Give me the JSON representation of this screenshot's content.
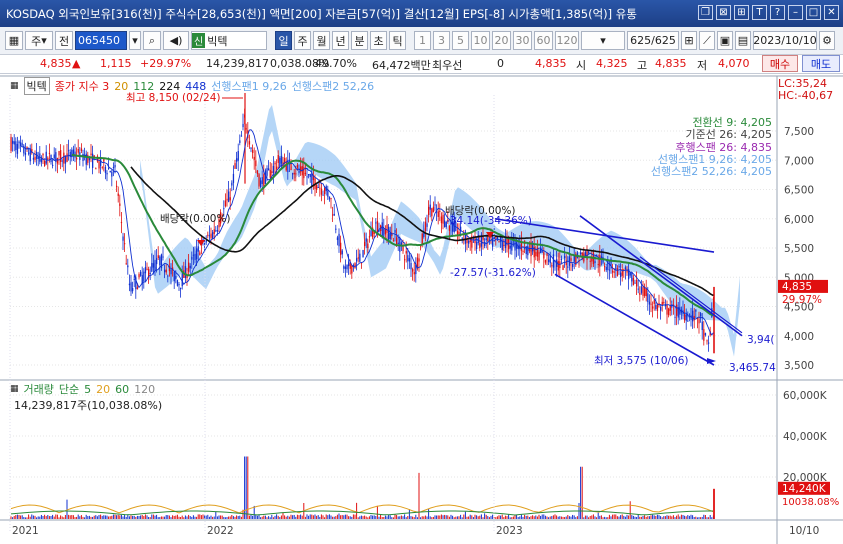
{
  "title_bar": {
    "text": "KOSDAQ 외국인보유[316(천)] 주식수[28,653(천)] 액면[200] 자본금[57(억)] 결산[12월] EPS[-8] 시가총액[1,385(억)] 유통",
    "icons": [
      "restore-icon",
      "close-box-icon",
      "pin-icon",
      "T",
      "?",
      "minimize-icon",
      "maximize-icon",
      "close-icon"
    ]
  },
  "toolbar": {
    "market": "주",
    "prev": "전",
    "code": "065450",
    "name_badge": "신",
    "name": "빅텍",
    "periods": [
      "일",
      "주",
      "월",
      "년",
      "분",
      "초",
      "틱"
    ],
    "active_period": "일",
    "intervals": [
      "1",
      "3",
      "5",
      "10",
      "20",
      "30",
      "60",
      "120"
    ],
    "count": "625/625",
    "date": "2023/10/10"
  },
  "quote": {
    "price": "4,835",
    "arrow": "▲",
    "change": "1,115",
    "rate": "+29.97%",
    "volume": "14,239,817",
    "vol_ratio": "0,038.08%",
    "pct2": "49.70%",
    "amount": "64,472백만",
    "pref_label": "최우선",
    "pref_value": "0",
    "cur": "4,835",
    "open_label": "시",
    "open": "4,325",
    "high_label": "고",
    "high": "4,835",
    "low_label": "저",
    "low": "4,070",
    "buy": "매수",
    "sell": "매도"
  },
  "price_pane": {
    "name_tag": "빅텍",
    "ma_label": "종가 지수 3",
    "ma_periods": [
      "20",
      "112",
      "224",
      "448"
    ],
    "span1": "선행스팬1 9,26",
    "span2": "선행스팬2 52,26",
    "lc": "LC:35,24",
    "hc": "HC:-40,67",
    "legend": [
      {
        "text": "전환선 9: 4,205",
        "color": "#2a8a3a"
      },
      {
        "text": "기준선 26: 4,205",
        "color": "#444444"
      },
      {
        "text": "후행스팬 26: 4,835",
        "color": "#9a2ab0"
      },
      {
        "text": "선행스팬1 9,26: 4,205",
        "color": "#6aa8e8"
      },
      {
        "text": "선행스팬2 52,26: 4,205",
        "color": "#6aa8e8"
      }
    ],
    "annotations": {
      "high": "최고 8,150 (02/24)",
      "low": "최저 3,575 (10/06)",
      "ex_div1": "배당락(0.00%)",
      "ex_div2": "배당락(0.00%)",
      "pct_upper": "-34.14(-34.36%)",
      "pct_lower": "-27.57(-31.62%)",
      "line_upper_end": "3,94(",
      "line_lower_end": "3,465.74"
    },
    "y_ticks": [
      "7,500",
      "7,000",
      "6,500",
      "6,000",
      "5,500",
      "5,000",
      "4,500",
      "4,000",
      "3,500"
    ],
    "cur_price_tag": "4,835",
    "cur_rate_tag": "29.97%"
  },
  "volume_pane": {
    "title": "거래량",
    "ma_label": "단순",
    "ma_periods": [
      "5",
      "20",
      "60",
      "120"
    ],
    "ma_colors": [
      "#e0a020",
      "#2a8a3a",
      "#444444"
    ],
    "value_text": "14,239,817주(10,038.08%)",
    "y_ticks": [
      "60,000K",
      "40,000K",
      "20,000K"
    ],
    "cur_tag": "14,240K",
    "cur_rate_tag": "10038.08%"
  },
  "x_axis": {
    "labels": [
      "2021",
      "2022",
      "2023"
    ],
    "right_label": "10/10"
  },
  "colors": {
    "up": "#e01010",
    "down": "#1030d0",
    "cloud": "#9cc8f4",
    "ma_black": "#111111",
    "ma_green": "#2a8a3a"
  }
}
